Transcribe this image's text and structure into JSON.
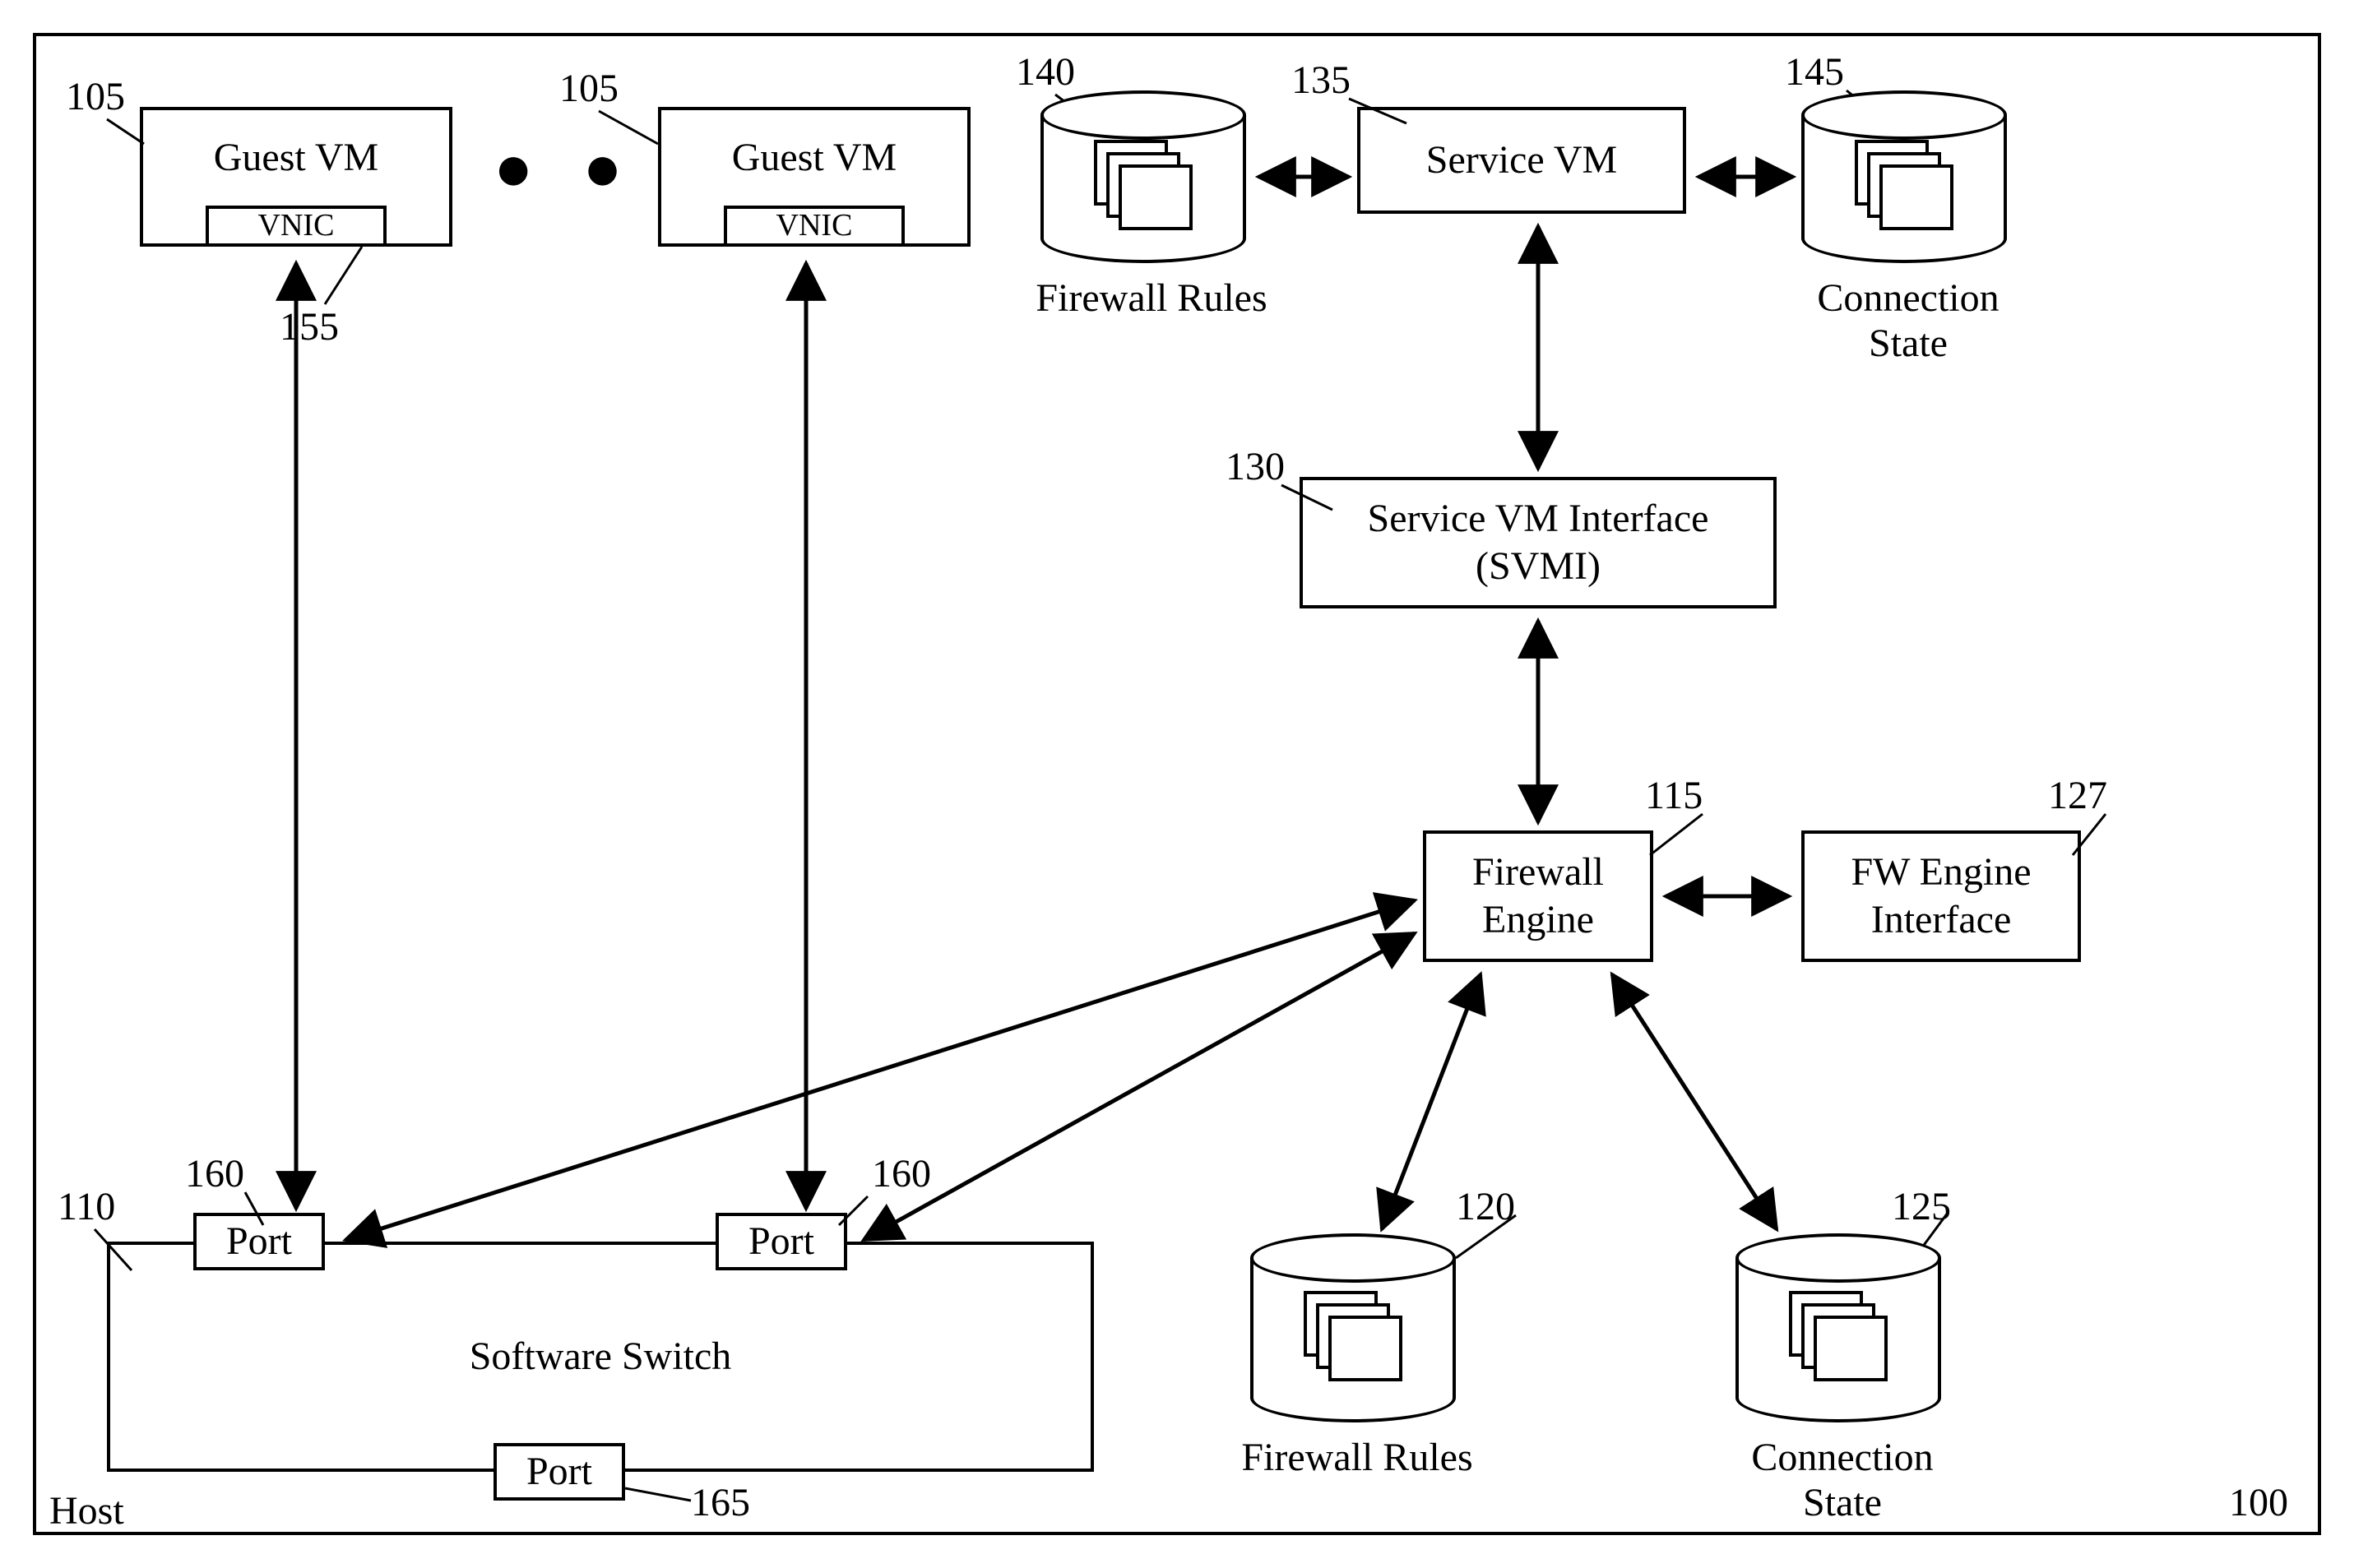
{
  "host_label": "Host",
  "host_ref": "100",
  "guest_vm_1": {
    "label": "Guest VM",
    "vnic": "VNIC",
    "ref": "105",
    "vnic_ref": "155"
  },
  "guest_vm_2": {
    "label": "Guest VM",
    "vnic": "VNIC",
    "ref": "105"
  },
  "ellipsis": "• • •",
  "firewall_rules_top": {
    "label": "Firewall Rules",
    "ref": "140"
  },
  "service_vm": {
    "label": "Service VM",
    "ref": "135"
  },
  "connection_state_top": {
    "label": "Connection State",
    "ref": "145"
  },
  "svmi": {
    "label": "Service VM Interface (SVMI)",
    "ref": "130"
  },
  "firewall_engine": {
    "label": "Firewall Engine",
    "ref": "115"
  },
  "fw_engine_interface": {
    "label": "FW Engine Interface",
    "ref": "127"
  },
  "software_switch": {
    "label": "Software Switch",
    "ref": "110"
  },
  "port_1": {
    "label": "Port",
    "ref": "160"
  },
  "port_2": {
    "label": "Port",
    "ref": "160"
  },
  "port_bottom": {
    "label": "Port",
    "ref": "165"
  },
  "firewall_rules_bottom": {
    "label": "Firewall Rules",
    "ref": "120"
  },
  "connection_state_bottom": {
    "label": "Connection State",
    "ref": "125"
  }
}
